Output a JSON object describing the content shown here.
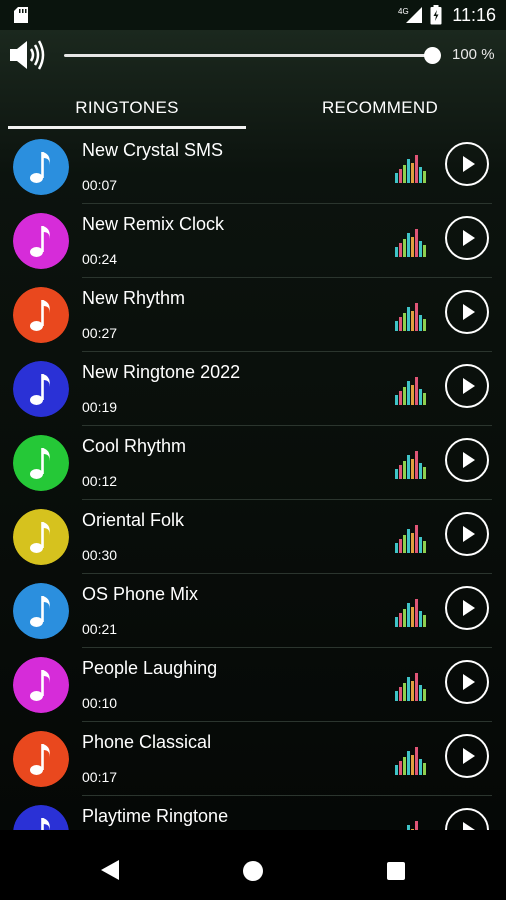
{
  "status_bar": {
    "time": "11:16",
    "network": "4G",
    "icons": [
      "sd-card-icon",
      "signal-icon",
      "battery-icon"
    ]
  },
  "volume": {
    "level_percent": 100,
    "label": "100 %",
    "icon": "speaker-icon"
  },
  "tabs": [
    {
      "label": "RINGTONES",
      "active": true
    },
    {
      "label": "RECOMMEND",
      "active": false
    }
  ],
  "ringtones": [
    {
      "title": "New Crystal SMS",
      "duration": "00:07",
      "color": "#2b8fde"
    },
    {
      "title": "New Remix Clock",
      "duration": "00:24",
      "color": "#d62cd9"
    },
    {
      "title": "New Rhythm",
      "duration": "00:27",
      "color": "#e9481e"
    },
    {
      "title": "New Ringtone 2022",
      "duration": "00:19",
      "color": "#2a31d6"
    },
    {
      "title": "Cool Rhythm",
      "duration": "00:12",
      "color": "#25c837"
    },
    {
      "title": "Oriental Folk",
      "duration": "00:30",
      "color": "#d6c21e"
    },
    {
      "title": "OS Phone Mix",
      "duration": "00:21",
      "color": "#2b8fde"
    },
    {
      "title": "People Laughing",
      "duration": "00:10",
      "color": "#d62cd9"
    },
    {
      "title": "Phone Classical",
      "duration": "00:17",
      "color": "#e9481e"
    },
    {
      "title": "Playtime Ringtone",
      "duration": "",
      "color": "#2a31d6"
    }
  ],
  "nav_bar": {
    "icons": [
      "back-icon",
      "home-icon",
      "recents-icon"
    ]
  }
}
